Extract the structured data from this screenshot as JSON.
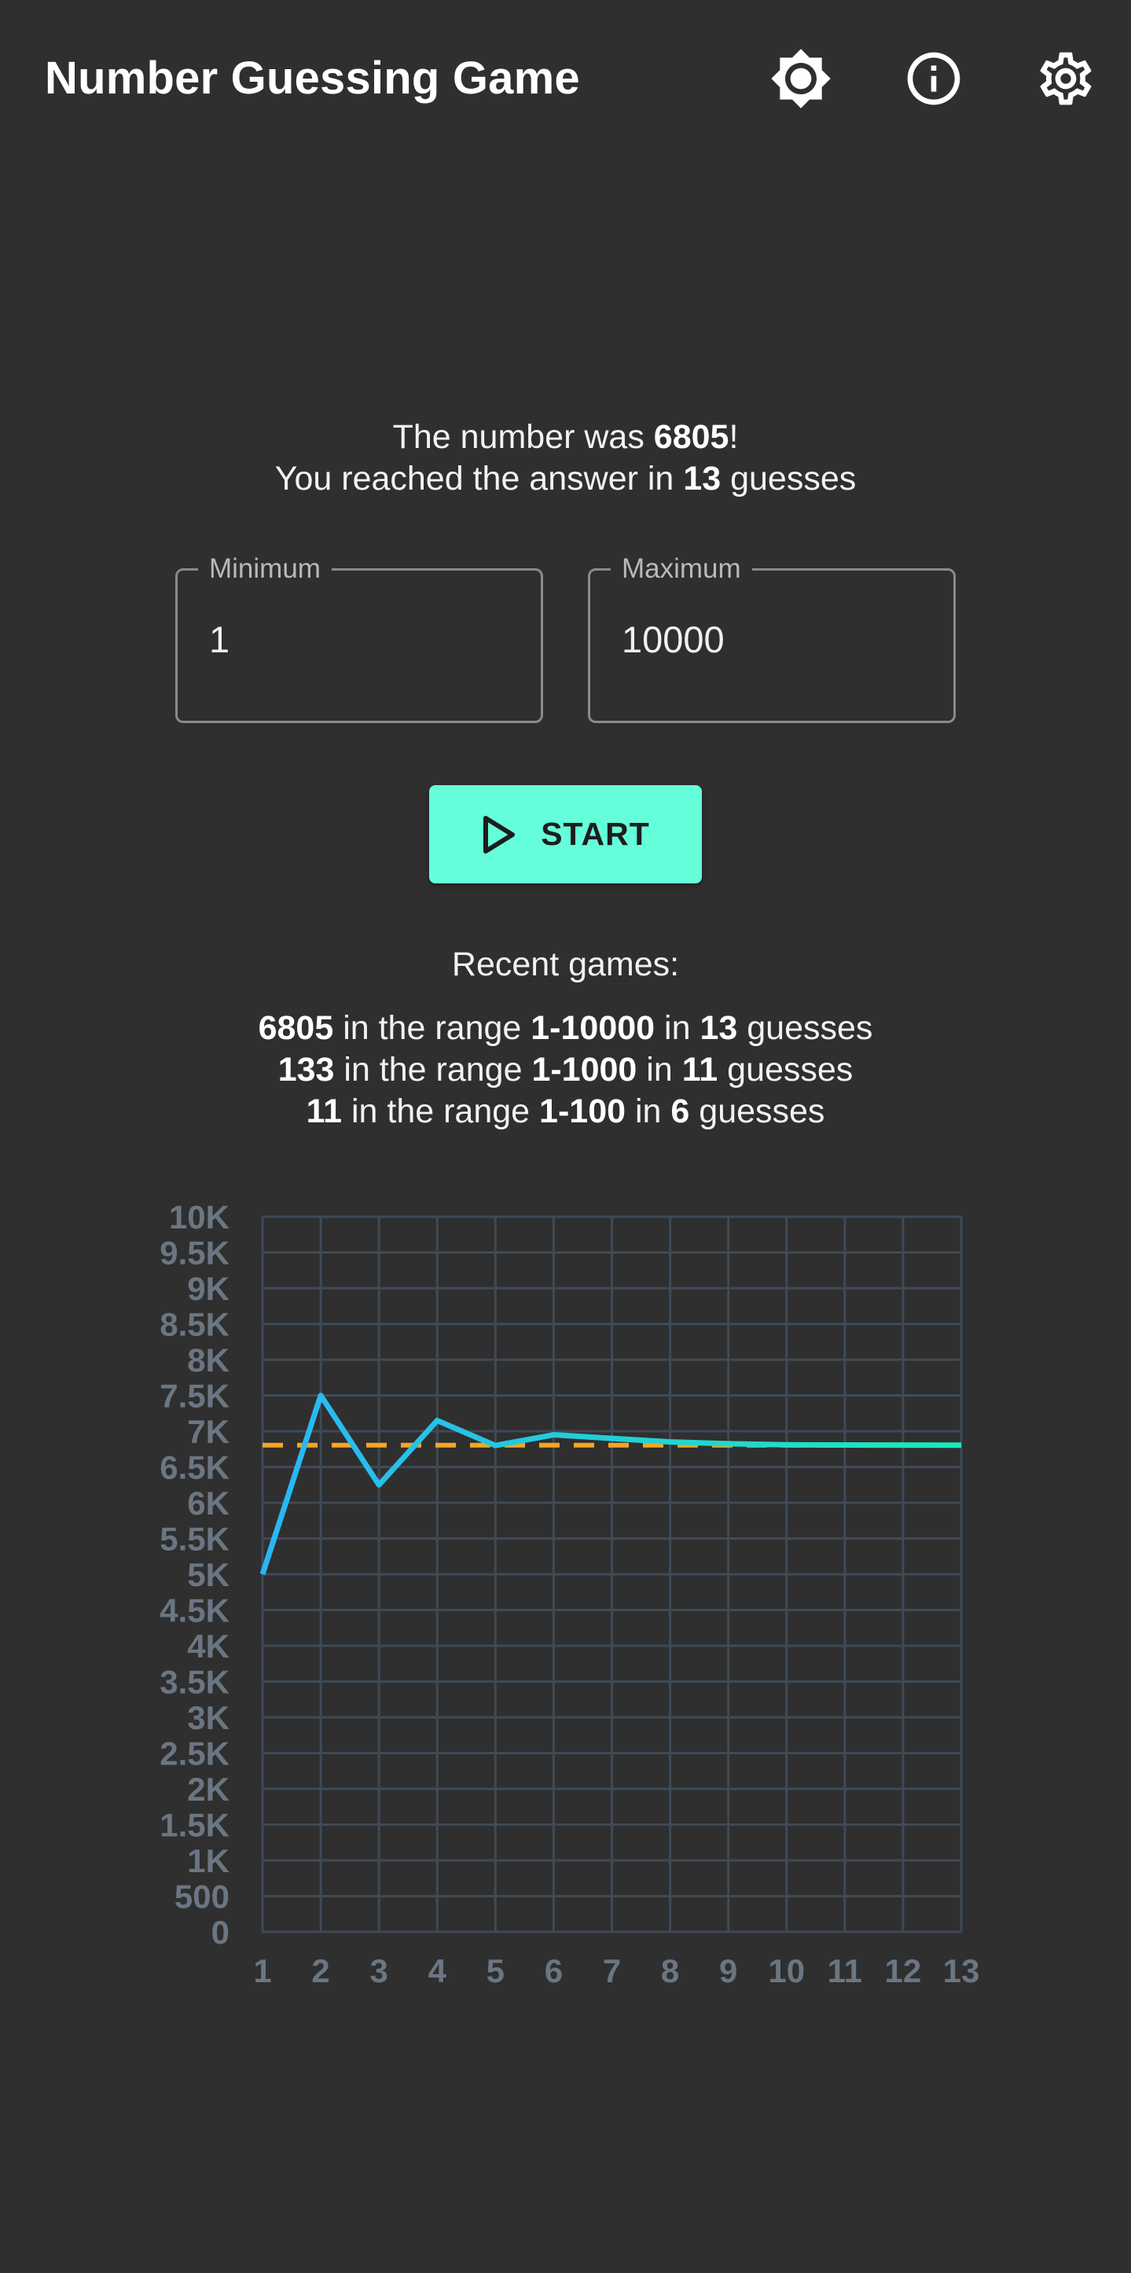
{
  "app": {
    "title": "Number Guessing Game",
    "icons": [
      "brightness-icon",
      "info-icon",
      "settings-icon"
    ]
  },
  "result": {
    "prefix": "The number was ",
    "number": "6805",
    "suffix": "!",
    "line2_prefix": "You reached the answer in ",
    "guesses": "13",
    "line2_suffix": " guesses"
  },
  "fields": {
    "minimum": {
      "label": "Minimum",
      "value": "1"
    },
    "maximum": {
      "label": "Maximum",
      "value": "10000"
    }
  },
  "start": {
    "label": "START",
    "icon": "play-icon"
  },
  "recent": {
    "heading": "Recent games:",
    "games": [
      {
        "number": "6805",
        "range": "1-10000",
        "guesses": "13"
      },
      {
        "number": "133",
        "range": "1-1000",
        "guesses": "11"
      },
      {
        "number": "11",
        "range": "1-100",
        "guesses": "6"
      }
    ],
    "text_range": " in the range ",
    "text_in": " in ",
    "text_guesses": " guesses"
  },
  "colors": {
    "background": "#2f2f2f",
    "accent": "#64ffda",
    "line_start": "#29b6f6",
    "line_end": "#1de9b6",
    "target": "#f5a623",
    "grid": "#3e4a57",
    "tick": "#6b7683"
  },
  "chart_data": {
    "type": "line",
    "x": [
      1,
      2,
      3,
      4,
      5,
      6,
      7,
      8,
      9,
      10,
      11,
      12,
      13
    ],
    "series": [
      {
        "values": [
          5000,
          7500,
          6250,
          7150,
          6800,
          6950,
          6900,
          6850,
          6825,
          6810,
          6808,
          6806,
          6805
        ]
      }
    ],
    "target_line": 6805,
    "ylim": [
      0,
      10000
    ],
    "yticks": [
      "0",
      "500",
      "1K",
      "1.5K",
      "2K",
      "2.5K",
      "3K",
      "3.5K",
      "4K",
      "4.5K",
      "5K",
      "5.5K",
      "6K",
      "6.5K",
      "7K",
      "7.5K",
      "8K",
      "8.5K",
      "9K",
      "9.5K",
      "10K"
    ],
    "xticks": [
      "1",
      "2",
      "3",
      "4",
      "5",
      "6",
      "7",
      "8",
      "9",
      "10",
      "11",
      "12",
      "13"
    ],
    "grid": true,
    "title": "",
    "xlabel": "",
    "ylabel": ""
  }
}
